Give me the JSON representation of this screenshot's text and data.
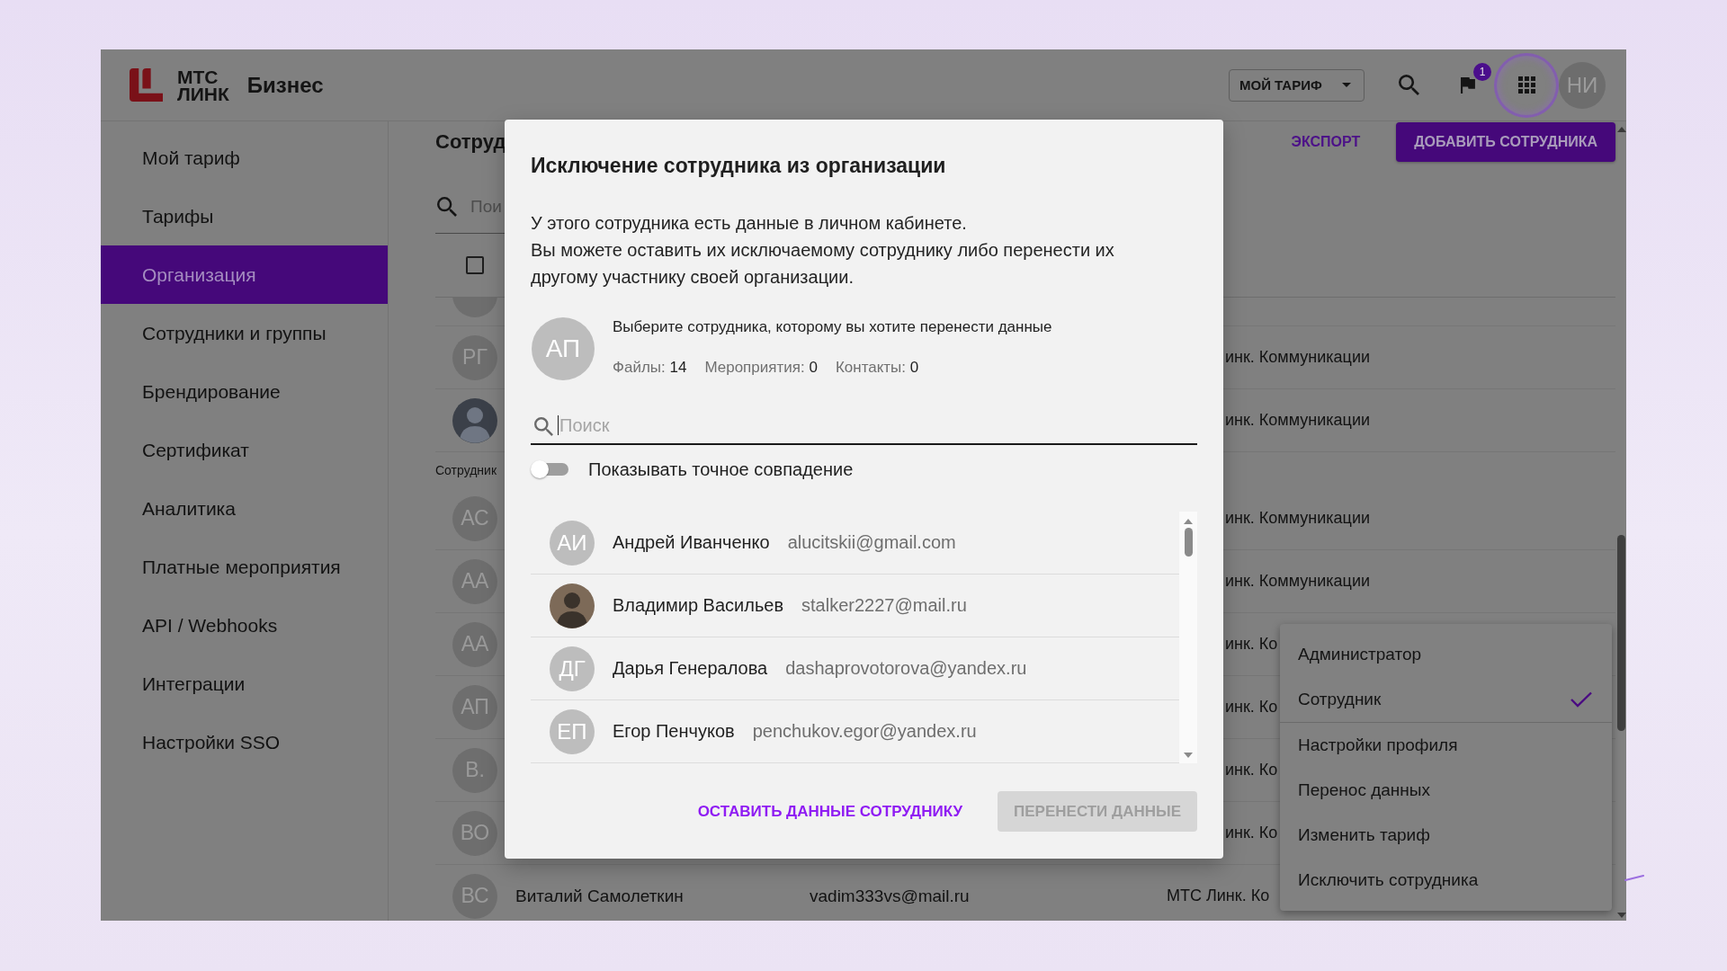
{
  "header": {
    "logo": {
      "line_1": "МТС",
      "line_2": "ЛИНК",
      "product": "Бизнес"
    },
    "tariff_button": {
      "label": "МОЙ ТАРИФ"
    },
    "notifications": {
      "badge": "1"
    },
    "apps_button": {
      "highlighted": true
    },
    "user_avatar": {
      "initials": "НИ"
    }
  },
  "sidebar": {
    "items": [
      {
        "label": "Мой тариф",
        "selected": false
      },
      {
        "label": "Тарифы",
        "selected": false
      },
      {
        "label": "Организация",
        "selected": true
      },
      {
        "label": "Сотрудники и группы",
        "selected": false
      },
      {
        "label": "Брендирование",
        "selected": false
      },
      {
        "label": "Сертификат",
        "selected": false
      },
      {
        "label": "Аналитика",
        "selected": false
      },
      {
        "label": "Платные мероприятия",
        "selected": false
      },
      {
        "label": "API / Webhooks",
        "selected": false
      },
      {
        "label": "Интеграции",
        "selected": false
      },
      {
        "label": "Настройки SSO",
        "selected": false
      }
    ]
  },
  "main": {
    "title": "Сотруд",
    "actions": [
      {
        "kind": "link",
        "label": "ЭКСПОРТ"
      },
      {
        "kind": "button",
        "label": "ДОБАВИТЬ СОТРУДНИКА"
      }
    ],
    "search": {
      "placeholder": "Пои"
    },
    "table": {
      "select_all": {
        "checked": false
      },
      "rows": [
        {
          "kind": "initials"
        },
        {
          "kind": "initials",
          "initials": "РГ",
          "organization": "инк. Коммуникации"
        },
        {
          "kind": "photo",
          "organization": "инк. Коммуникации"
        },
        {
          "kind": "group",
          "label": "Сотрудник"
        },
        {
          "kind": "initials",
          "initials": "АС",
          "organization": "инк. Коммуникации"
        },
        {
          "kind": "initials",
          "initials": "АА",
          "organization": "инк. Коммуникации"
        },
        {
          "kind": "initials",
          "initials": "АА",
          "organization": "инк. Ко"
        },
        {
          "kind": "initials",
          "initials": "АП",
          "organization": "инк. Ко"
        },
        {
          "kind": "initials",
          "initials": "В.",
          "organization": "инк. Ко"
        },
        {
          "kind": "initials",
          "initials": "ВО",
          "organization": "инк. Ко"
        },
        {
          "kind": "initials",
          "initials": "ВС",
          "name": "Виталий Самолеткин",
          "email": "vadim333vs@mail.ru",
          "organization": "МТС Линк. Ко"
        }
      ]
    }
  },
  "modal": {
    "title": "Исключение сотрудника из организации",
    "description": [
      "У этого сотрудника есть данные в личном кабинете.",
      "Вы можете оставить их исключаемому сотруднику либо перенести их другому участнику своей организации."
    ],
    "employee": {
      "initials": "АП"
    },
    "prompt": "Выберите сотрудника, которому вы хотите перенести данные",
    "stats": [
      {
        "label": "Файлы:",
        "value": "14"
      },
      {
        "label": "Мероприятия:",
        "value": "0"
      },
      {
        "label": "Контакты:",
        "value": "0"
      }
    ],
    "search": {
      "placeholder": "Поиск",
      "focused": true
    },
    "exact_match": {
      "label": "Показывать точное совпадение",
      "on": false
    },
    "employees": [
      {
        "kind": "initials",
        "initials": "АИ",
        "name": "Андрей Иванченко",
        "email": "alucitskii@gmail.com",
        "selected": false
      },
      {
        "kind": "photo",
        "name": "Владимир Васильев",
        "email": "stalker2227@mail.ru",
        "selected": false
      },
      {
        "kind": "initials",
        "initials": "ДГ",
        "name": "Дарья Генералова",
        "email": "dashaprovotorova@yandex.ru",
        "selected": false
      },
      {
        "kind": "initials",
        "initials": "ЕП",
        "name": "Егор Пенчуков",
        "email": "penchukov.egor@yandex.ru",
        "selected": false
      }
    ],
    "buttons": [
      {
        "kind": "text",
        "label": "ОСТАВИТЬ ДАННЫЕ СОТРУДНИКУ",
        "disabled": false
      },
      {
        "kind": "contained",
        "label": "ПЕРЕНЕСТИ ДАННЫЕ",
        "disabled": true
      }
    ]
  },
  "context_menu": {
    "roles": [
      {
        "label": "Администратор",
        "selected": false
      },
      {
        "label": "Сотрудник",
        "selected": true
      }
    ],
    "actions": [
      {
        "label": "Настройки профиля"
      },
      {
        "label": "Перенос данных"
      },
      {
        "label": "Изменить тариф"
      },
      {
        "label": "Исключить сотрудника"
      }
    ]
  }
}
